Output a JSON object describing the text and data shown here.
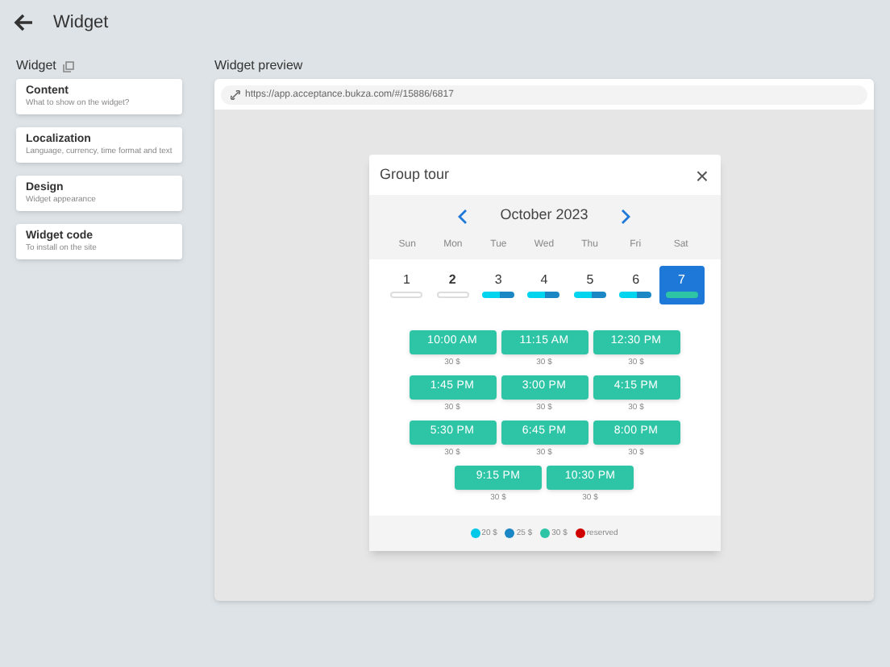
{
  "header": {
    "title": "Widget"
  },
  "sidebar": {
    "title": "Widget",
    "items": [
      {
        "title": "Content",
        "subtitle": "What to show on the widget?"
      },
      {
        "title": "Localization",
        "subtitle": "Language, currency, time format and text"
      },
      {
        "title": "Design",
        "subtitle": "Widget appearance"
      },
      {
        "title": "Widget code",
        "subtitle": "To install on the site"
      }
    ]
  },
  "preview": {
    "title": "Widget preview",
    "url": "https://app.acceptance.bukza.com/#/15886/6817",
    "modal": {
      "title": "Group tour",
      "close": "×",
      "month": "October 2023",
      "weekdays": [
        "Sun",
        "Mon",
        "Tue",
        "Wed",
        "Thu",
        "Fri",
        "Sat"
      ],
      "days": [
        {
          "label": "1",
          "selected": false,
          "today": false,
          "kind": "empty"
        },
        {
          "label": "2",
          "selected": false,
          "today": true,
          "kind": "empty"
        },
        {
          "label": "3",
          "selected": false,
          "today": false,
          "kind": "mixed"
        },
        {
          "label": "4",
          "selected": false,
          "today": false,
          "kind": "mixed"
        },
        {
          "label": "5",
          "selected": false,
          "today": false,
          "kind": "mixed"
        },
        {
          "label": "6",
          "selected": false,
          "today": false,
          "kind": "mixed"
        },
        {
          "label": "7",
          "selected": true,
          "today": false,
          "kind": "full"
        }
      ],
      "slot_rows": [
        [
          {
            "time": "10:00 AM",
            "price": "30 $"
          },
          {
            "time": "11:15 AM",
            "price": "30 $"
          },
          {
            "time": "12:30 PM",
            "price": "30 $"
          }
        ],
        [
          {
            "time": "1:45 PM",
            "price": "30 $"
          },
          {
            "time": "3:00 PM",
            "price": "30 $"
          },
          {
            "time": "4:15 PM",
            "price": "30 $"
          }
        ],
        [
          {
            "time": "5:30 PM",
            "price": "30 $"
          },
          {
            "time": "6:45 PM",
            "price": "30 $"
          },
          {
            "time": "8:00 PM",
            "price": "30 $"
          }
        ],
        [
          {
            "time": "9:15 PM",
            "price": "30 $"
          },
          {
            "time": "10:30 PM",
            "price": "30 $"
          }
        ]
      ],
      "legend": [
        {
          "label": "20 $",
          "color": "#00c8e8"
        },
        {
          "label": "25 $",
          "color": "#1b87c4"
        },
        {
          "label": "30 $",
          "color": "#2ec4a6"
        },
        {
          "label": "reserved",
          "color": "#d00000"
        }
      ]
    }
  }
}
